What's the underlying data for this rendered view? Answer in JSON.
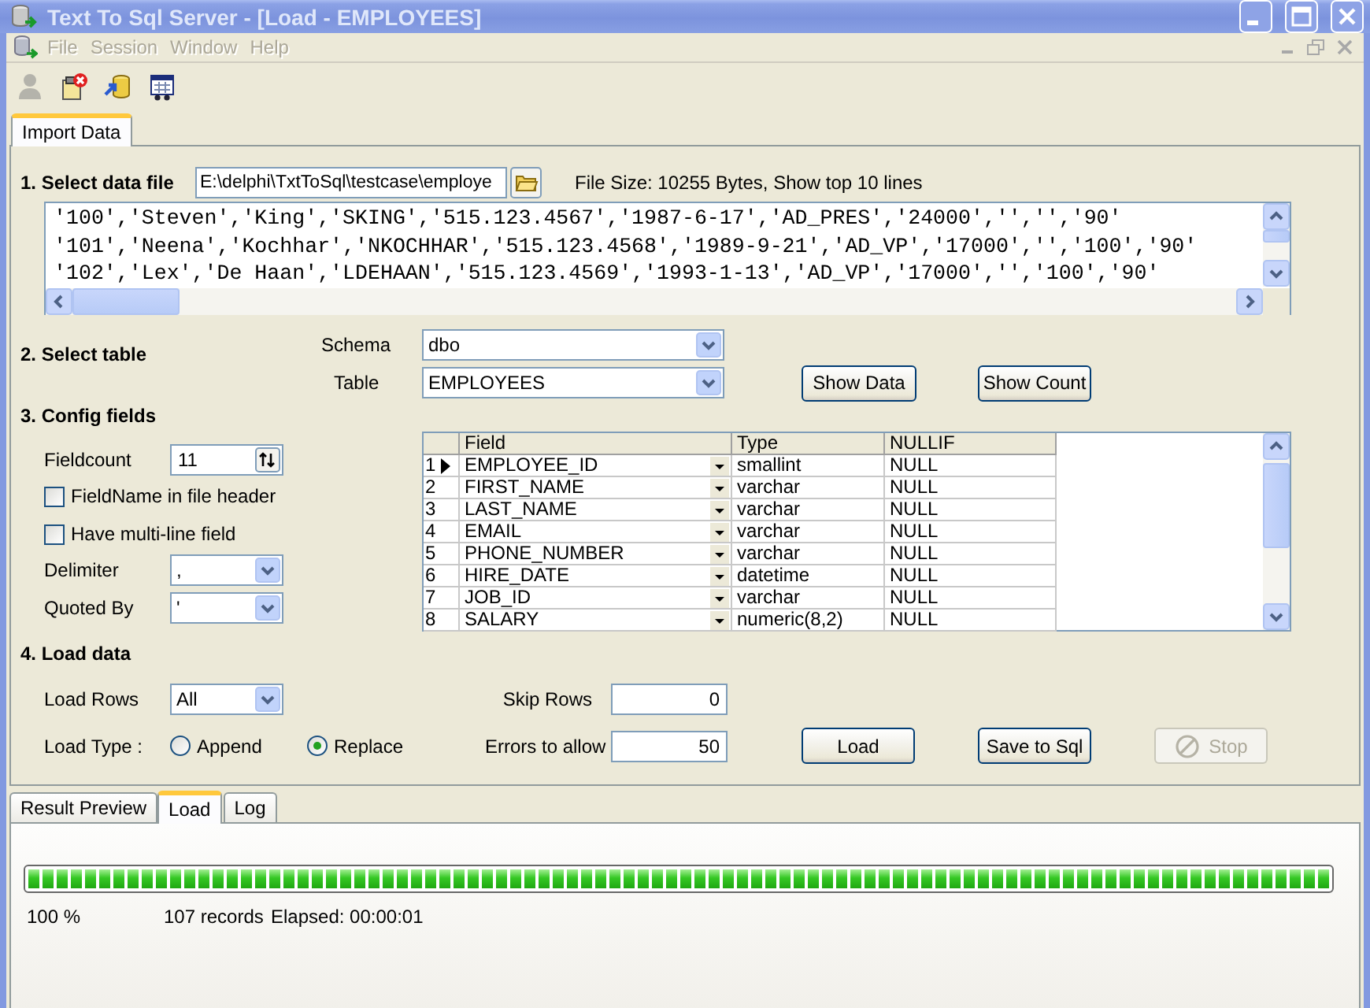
{
  "window": {
    "title": "Text To Sql Server - [Load - EMPLOYEES]"
  },
  "menu": [
    {
      "label": "File",
      "disabled": true
    },
    {
      "label": "Session",
      "disabled": true
    },
    {
      "label": "Window",
      "disabled": true
    },
    {
      "label": "Help",
      "disabled": true
    }
  ],
  "toolbar": [
    {
      "kind": "person",
      "disabled": true
    },
    {
      "kind": "page-error",
      "disabled": false
    },
    {
      "kind": "database-import",
      "disabled": false
    },
    {
      "kind": "window",
      "disabled": false
    }
  ],
  "top_tabs": [
    {
      "label": "Import Data",
      "selected": true
    }
  ],
  "data_file": {
    "heading": "1. Select data file",
    "path": "E:\\delphi\\TxtToSql\\testcase\\employe",
    "info": "File Size: 10255 Bytes,  Show top 10 lines",
    "preview_lines": [
      "'100','Steven','King','SKING','515.123.4567','1987-6-17','AD_PRES','24000','','','90'",
      "'101','Neena','Kochhar','NKOCHHAR','515.123.4568','1989-9-21','AD_VP','17000','','100','90'",
      "'102','Lex','De Haan','LDEHAAN','515.123.4569','1993-1-13','AD_VP','17000','','100','90'"
    ]
  },
  "table_select": {
    "heading": "2. Select table",
    "schema_label": "Schema",
    "schema": "dbo",
    "table_label": "Table",
    "table": "EMPLOYEES",
    "buttons": [
      "Show Data",
      "Show Count"
    ]
  },
  "config": {
    "heading": "3. Config fields",
    "fieldcount_label": "Fieldcount",
    "fieldcount": "11",
    "options": [
      {
        "label": "FieldName in file header",
        "checked": false
      },
      {
        "label": "Have multi-line field",
        "checked": false
      }
    ],
    "delimiter_label": "Delimiter",
    "delimiter": ",",
    "quoted_by_label": "Quoted By",
    "quoted_by": "'"
  },
  "fields_grid": {
    "columns": [
      "Field",
      "Type",
      "NULLIF"
    ],
    "rows": [
      {
        "number": "1",
        "selected": true,
        "field": "EMPLOYEE_ID",
        "type": "smallint",
        "nullif": "NULL"
      },
      {
        "number": "2",
        "selected": false,
        "field": "FIRST_NAME",
        "type": "varchar",
        "nullif": "NULL"
      },
      {
        "number": "3",
        "selected": false,
        "field": "LAST_NAME",
        "type": "varchar",
        "nullif": "NULL"
      },
      {
        "number": "4",
        "selected": false,
        "field": "EMAIL",
        "type": "varchar",
        "nullif": "NULL"
      },
      {
        "number": "5",
        "selected": false,
        "field": "PHONE_NUMBER",
        "type": "varchar",
        "nullif": "NULL"
      },
      {
        "number": "6",
        "selected": false,
        "field": "HIRE_DATE",
        "type": "datetime",
        "nullif": "NULL"
      },
      {
        "number": "7",
        "selected": false,
        "field": "JOB_ID",
        "type": "varchar",
        "nullif": "NULL"
      },
      {
        "number": "8",
        "selected": false,
        "field": "SALARY",
        "type": "numeric(8,2)",
        "nullif": "NULL"
      }
    ]
  },
  "load": {
    "heading": "4. Load data",
    "load_rows_label": "Load Rows",
    "load_rows": "All",
    "load_type_label": "Load Type :",
    "load_types": [
      {
        "label": "Append",
        "selected": false
      },
      {
        "label": "Replace",
        "selected": true
      }
    ],
    "skip_rows_label": "Skip Rows",
    "skip_rows": "0",
    "errors_label": "Errors to allow",
    "errors": "50",
    "buttons": [
      {
        "label": "Load",
        "disabled": false
      },
      {
        "label": "Save to Sql",
        "disabled": false
      },
      {
        "label": "Stop",
        "disabled": true,
        "kind": "stop"
      }
    ]
  },
  "bottom_tabs": [
    {
      "label": "Result Preview",
      "selected": false
    },
    {
      "label": "Load",
      "selected": true
    },
    {
      "label": "Log",
      "selected": false
    }
  ],
  "progress": {
    "level": 1,
    "percent": "100 %",
    "records": "107 records",
    "elapsed": "Elapsed: 00:00:01"
  }
}
